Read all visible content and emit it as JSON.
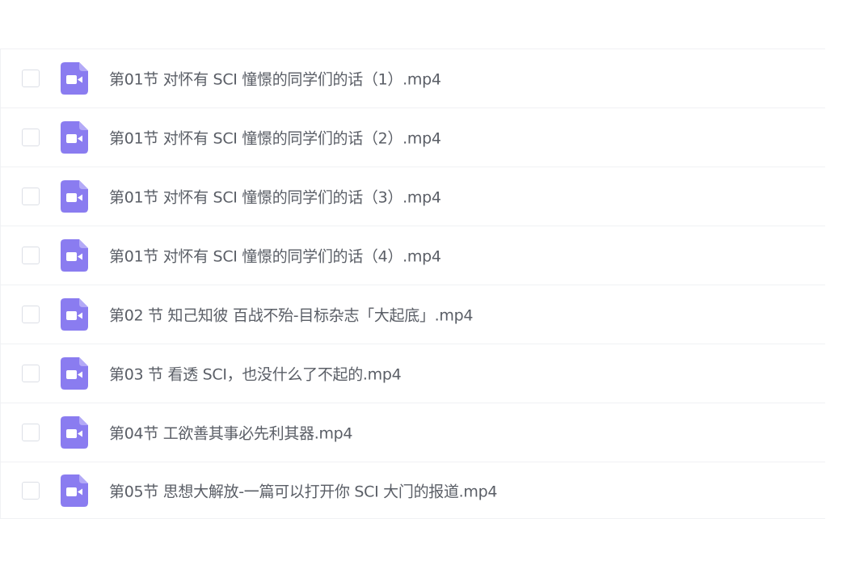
{
  "colors": {
    "icon_fill": "#8a7cf0",
    "icon_glyph": "#ffffff",
    "text": "#5a5e66",
    "divider": "#f0f1f4"
  },
  "files": [
    {
      "name": "第01节 对怀有 SCI 憧憬的同学们的话（1）.mp4",
      "icon": "video-file-icon"
    },
    {
      "name": "第01节 对怀有 SCI 憧憬的同学们的话（2）.mp4",
      "icon": "video-file-icon"
    },
    {
      "name": "第01节 对怀有 SCI 憧憬的同学们的话（3）.mp4",
      "icon": "video-file-icon"
    },
    {
      "name": "第01节 对怀有 SCI 憧憬的同学们的话（4）.mp4",
      "icon": "video-file-icon"
    },
    {
      "name": "第02 节 知己知彼 百战不殆-目标杂志「大起底」.mp4",
      "icon": "video-file-icon"
    },
    {
      "name": "第03 节 看透 SCI，也没什么了不起的.mp4",
      "icon": "video-file-icon"
    },
    {
      "name": "第04节 工欲善其事必先利其器.mp4",
      "icon": "video-file-icon"
    },
    {
      "name": "第05节 思想大解放-一篇可以打开你 SCI 大门的报道.mp4",
      "icon": "video-file-icon"
    }
  ]
}
